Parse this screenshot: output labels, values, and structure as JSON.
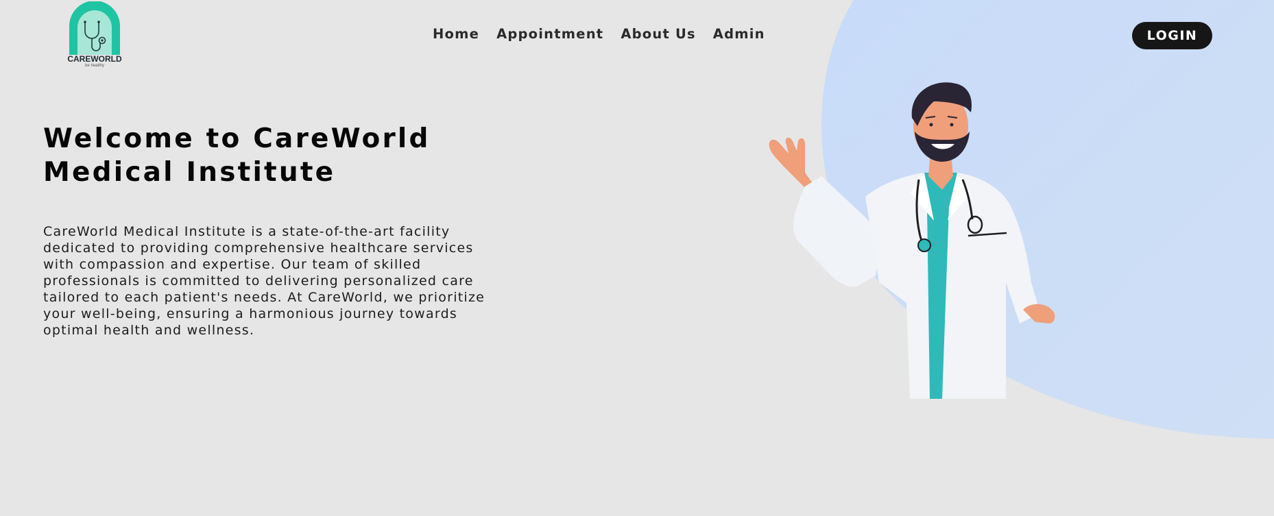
{
  "brand": {
    "logo_icon": "stethoscope-arch-logo",
    "name": "CAREWORLD",
    "tagline": "be healthy"
  },
  "nav": {
    "items": [
      {
        "label": "Home"
      },
      {
        "label": "Appointment"
      },
      {
        "label": "About Us"
      },
      {
        "label": "Admin"
      }
    ]
  },
  "header": {
    "login_label": "LOGIN"
  },
  "hero": {
    "title_line1": "Welcome to CareWorld",
    "title_line2": "Medical Institute",
    "description": "CareWorld Medical Institute is a state-of-the-art facility dedicated to providing comprehensive healthcare services with compassion and expertise. Our team of skilled professionals is committed to delivering personalized care tailored to each patient's needs. At CareWorld, we prioritize your well-being, ensuring a harmonious journey towards optimal health and wellness.",
    "illustration": "doctor-waving-illustration"
  },
  "colors": {
    "background": "#e6e6e6",
    "blob": "#cadcf7",
    "accent_teal": "#1fc4a3",
    "button_bg": "#161616",
    "text_dark": "#060606"
  }
}
